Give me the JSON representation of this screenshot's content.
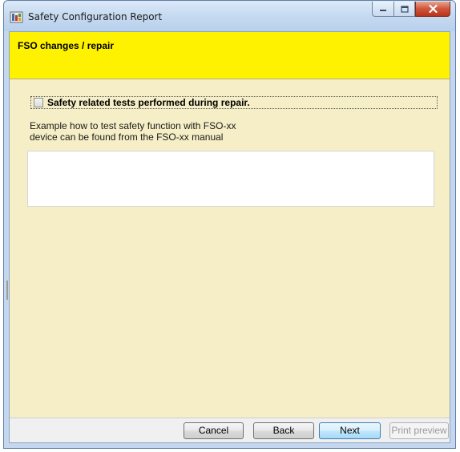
{
  "window": {
    "title": "Safety Configuration Report",
    "caption_buttons": [
      "minimize",
      "maximize",
      "close"
    ]
  },
  "header": {
    "title": "FSO changes / repair"
  },
  "checkbox": {
    "label": "Safety related tests performed during repair.",
    "checked": false
  },
  "info": {
    "line1": "Example how to test safety function with FSO-xx",
    "line2": "device can be found from the FSO-xx manual"
  },
  "notes": {
    "value": ""
  },
  "footer": {
    "cancel_label": "Cancel",
    "back_label": "Back",
    "next_label": "Next",
    "print_preview_label": "Print preview"
  },
  "colors": {
    "header_band": "#fff200",
    "client_background": "#f5eec6",
    "close_button": "#c84a30"
  },
  "icons": {
    "app": "report-app-icon",
    "minimize": "minimize-icon",
    "maximize": "maximize-icon",
    "close": "close-icon"
  }
}
